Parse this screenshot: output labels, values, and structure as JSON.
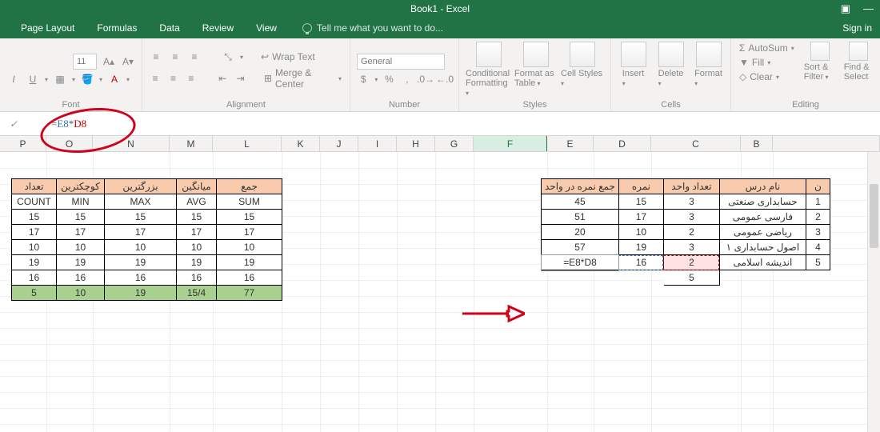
{
  "title": "Book1 - Excel",
  "tabs": [
    "Page Layout",
    "Formulas",
    "Data",
    "Review",
    "View"
  ],
  "tellme": "Tell me what you want to do...",
  "signin": "Sign in",
  "ribbon": {
    "font_size": "11",
    "font_label": "Font",
    "wrap": "Wrap Text",
    "merge": "Merge & Center",
    "align_label": "Alignment",
    "numfmt": "General",
    "number_label": "Number",
    "cond": "Conditional Formatting",
    "fmtas": "Format as Table",
    "cstyles": "Cell Styles",
    "styles_label": "Styles",
    "insert": "Insert",
    "delete": "Delete",
    "format": "Format",
    "cells_label": "Cells",
    "autosum": "AutoSum",
    "fill": "Fill",
    "clear": "Clear",
    "sortf": "Sort & Filter",
    "find": "Find & Select",
    "editing_label": "Editing"
  },
  "formula": "=E8*D8",
  "formula_display_plain": "=",
  "formula_display_e": "E8",
  "formula_display_star": "*",
  "formula_display_d": "D8",
  "cols": [
    "P",
    "O",
    "N",
    "M",
    "L",
    "K",
    "J",
    "I",
    "H",
    "G",
    "F",
    "E",
    "D",
    "C",
    "B"
  ],
  "right_table": {
    "headers": [
      "جمع نمره در واحد",
      "نمره",
      "تعداد واحد",
      "نام درس",
      ""
    ],
    "idx_header": "ن",
    "rows": [
      {
        "f": "45",
        "e": "15",
        "d": "3",
        "c": "حسابداری صنعتی",
        "b": "1"
      },
      {
        "f": "51",
        "e": "17",
        "d": "3",
        "c": "فارسی عمومی",
        "b": "2"
      },
      {
        "f": "20",
        "e": "10",
        "d": "2",
        "c": "ریاضی عمومی",
        "b": "3"
      },
      {
        "f": "57",
        "e": "19",
        "d": "3",
        "c": "اصول حسابداری ۱",
        "b": "4"
      },
      {
        "f": "=E8*D8",
        "e": "16",
        "d": "2",
        "c": "اندیشه اسلامی",
        "b": "5"
      }
    ],
    "footer_d": "5"
  },
  "left_table": {
    "headers": [
      "تعداد",
      "کوچکترین",
      "بزرگترین",
      "میانگین",
      "جمع"
    ],
    "sub": [
      "COUNT",
      "MIN",
      "MAX",
      "AVG",
      "SUM"
    ],
    "rows": [
      [
        "15",
        "15",
        "15",
        "15",
        "15"
      ],
      [
        "17",
        "17",
        "17",
        "17",
        "17"
      ],
      [
        "10",
        "10",
        "10",
        "10",
        "10"
      ],
      [
        "19",
        "19",
        "19",
        "19",
        "19"
      ],
      [
        "16",
        "16",
        "16",
        "16",
        "16"
      ]
    ],
    "total": [
      "5",
      "10",
      "19",
      "15/4",
      "77"
    ]
  }
}
